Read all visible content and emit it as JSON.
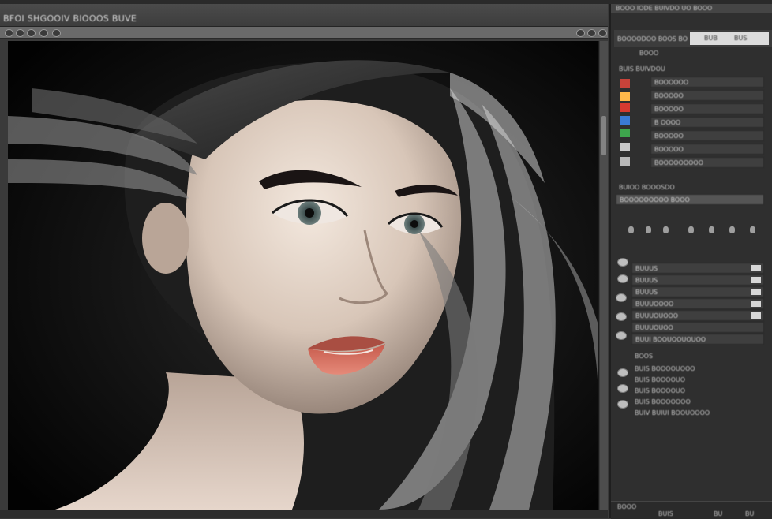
{
  "window": {
    "document_title": "BFOI SHGOOIV BIOOOS BUVE"
  },
  "panel": {
    "header_label": "BOOO IODE BUIVDO UO BOOO",
    "top_label": "BOOOODOO BOOS BO",
    "mode_tabs": [
      "BUB",
      "BUS"
    ],
    "subheader": "BOOO",
    "row_header_label": "BUIS BUIVDOU",
    "group_label": "BUIOO BOOOSDO",
    "active_layer_label": "BOOOOOOOOO BOOO",
    "layers": [
      "BOOOOOO",
      "BOOOOO",
      "BOOOOO",
      "B OOOO",
      "BOOOOO",
      "BOOOOO",
      "BOOOOOOOOO"
    ],
    "adjustment_rows": [
      "BUUUS",
      "BUUUS",
      "BUUUS",
      "BUUUOOOO",
      "BUUUOUOOO",
      "BUUUOUOO",
      "BUUI BOOUOOUOUOO"
    ],
    "properties_title": "BOOS",
    "properties_rows": [
      "BUIS BOOOOUOOO",
      "BUIS BOOOOUO",
      "BUIS BOOOOUO",
      "BUIS BOOOOOOO",
      "BUIV BUIUI BOOUOOOO"
    ],
    "footer_labels": [
      "BOOO",
      "BUIS",
      "BU",
      "BU"
    ]
  },
  "colors": {
    "window_bg": "#3a3a3a",
    "panel_bg": "#2f2f2f",
    "canvas_bg": "#050505",
    "tab_strip": "#6a6a6a"
  },
  "icons": {
    "layer_visibility": "eye-icon",
    "document_tab_buttons": "circle-button-icon"
  }
}
